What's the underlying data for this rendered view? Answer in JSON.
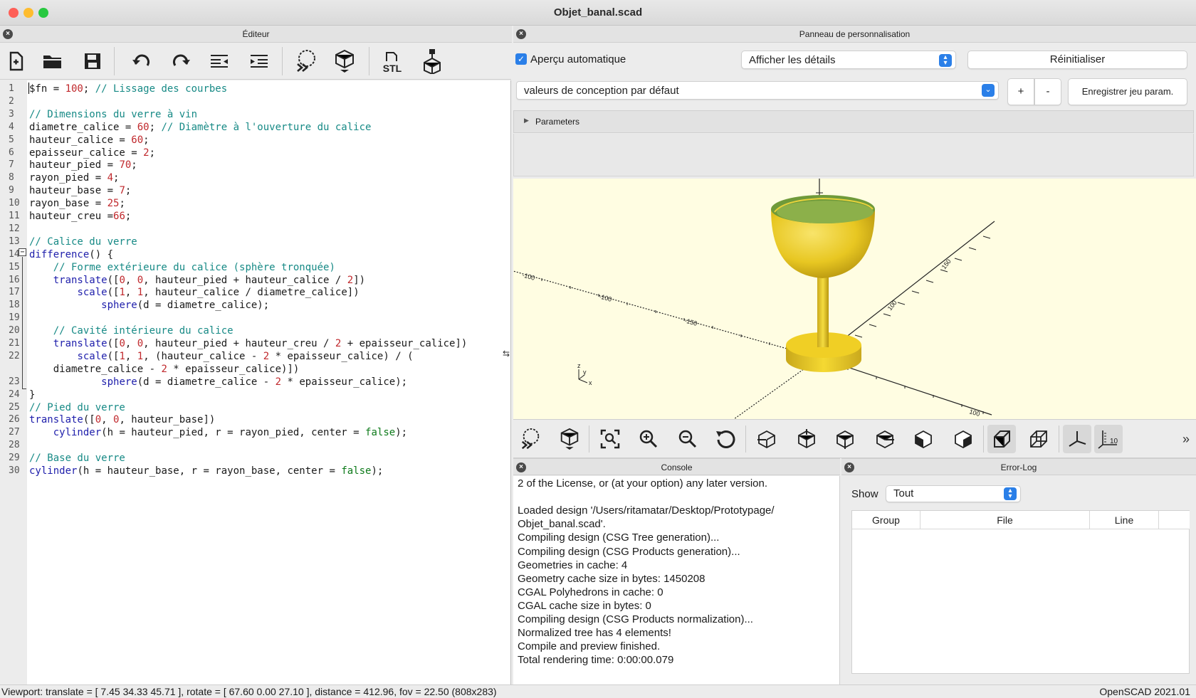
{
  "window": {
    "title": "Objet_banal.scad",
    "colors": {
      "close": "#fe5f57",
      "minimize": "#febc2e",
      "zoom": "#28c840"
    }
  },
  "editor": {
    "header": "Éditeur",
    "toolbar": [
      "new-file-icon",
      "open-folder-icon",
      "save-icon",
      "undo-icon",
      "redo-icon",
      "unindent-icon",
      "indent-icon",
      "preview-icon",
      "render-icon",
      "export-stl-icon",
      "send-to-3d-print-icon"
    ],
    "stl_label": "STL",
    "lines": [
      {
        "n": "1",
        "t": [
          [
            "pl",
            "$fn = "
          ],
          [
            "num",
            "100"
          ],
          [
            "pl",
            "; "
          ],
          [
            "cm",
            "// Lissage des courbes"
          ]
        ]
      },
      {
        "n": "2",
        "t": []
      },
      {
        "n": "3",
        "t": [
          [
            "cm",
            "// Dimensions du verre à vin"
          ]
        ]
      },
      {
        "n": "4",
        "t": [
          [
            "pl",
            "diametre_calice = "
          ],
          [
            "num",
            "60"
          ],
          [
            "pl",
            "; "
          ],
          [
            "cm",
            "// Diamètre à l'ouverture du calice"
          ]
        ]
      },
      {
        "n": "5",
        "t": [
          [
            "pl",
            "hauteur_calice = "
          ],
          [
            "num",
            "60"
          ],
          [
            "pl",
            ";"
          ]
        ]
      },
      {
        "n": "6",
        "t": [
          [
            "pl",
            "epaisseur_calice = "
          ],
          [
            "num",
            "2"
          ],
          [
            "pl",
            ";"
          ]
        ]
      },
      {
        "n": "7",
        "t": [
          [
            "pl",
            "hauteur_pied = "
          ],
          [
            "num",
            "70"
          ],
          [
            "pl",
            ";"
          ]
        ]
      },
      {
        "n": "8",
        "t": [
          [
            "pl",
            "rayon_pied = "
          ],
          [
            "num",
            "4"
          ],
          [
            "pl",
            ";"
          ]
        ]
      },
      {
        "n": "9",
        "t": [
          [
            "pl",
            "hauteur_base = "
          ],
          [
            "num",
            "7"
          ],
          [
            "pl",
            ";"
          ]
        ]
      },
      {
        "n": "10",
        "t": [
          [
            "pl",
            "rayon_base = "
          ],
          [
            "num",
            "25"
          ],
          [
            "pl",
            ";"
          ]
        ]
      },
      {
        "n": "11",
        "t": [
          [
            "pl",
            "hauteur_creu ="
          ],
          [
            "num",
            "66"
          ],
          [
            "pl",
            ";"
          ]
        ]
      },
      {
        "n": "12",
        "t": []
      },
      {
        "n": "13",
        "t": [
          [
            "cm",
            "// Calice du verre"
          ]
        ]
      },
      {
        "n": "14",
        "t": [
          [
            "kw",
            "difference"
          ],
          [
            "pl",
            "() {"
          ]
        ]
      },
      {
        "n": "15",
        "t": [
          [
            "pl",
            "    "
          ],
          [
            "cm",
            "// Forme extérieure du calice (sphère tronquée)"
          ]
        ]
      },
      {
        "n": "16",
        "t": [
          [
            "pl",
            "    "
          ],
          [
            "kw",
            "translate"
          ],
          [
            "pl",
            "(["
          ],
          [
            "num",
            "0"
          ],
          [
            "pl",
            ", "
          ],
          [
            "num",
            "0"
          ],
          [
            "pl",
            ", hauteur_pied + hauteur_calice / "
          ],
          [
            "num",
            "2"
          ],
          [
            "pl",
            "])"
          ]
        ]
      },
      {
        "n": "17",
        "t": [
          [
            "pl",
            "        "
          ],
          [
            "kw",
            "scale"
          ],
          [
            "pl",
            "(["
          ],
          [
            "num",
            "1"
          ],
          [
            "pl",
            ", "
          ],
          [
            "num",
            "1"
          ],
          [
            "pl",
            ", hauteur_calice / diametre_calice])"
          ]
        ]
      },
      {
        "n": "18",
        "t": [
          [
            "pl",
            "            "
          ],
          [
            "kw",
            "sphere"
          ],
          [
            "pl",
            "(d = diametre_calice);"
          ]
        ]
      },
      {
        "n": "19",
        "t": []
      },
      {
        "n": "20",
        "t": [
          [
            "pl",
            "    "
          ],
          [
            "cm",
            "// Cavité intérieure du calice"
          ]
        ]
      },
      {
        "n": "21",
        "t": [
          [
            "pl",
            "    "
          ],
          [
            "kw",
            "translate"
          ],
          [
            "pl",
            "(["
          ],
          [
            "num",
            "0"
          ],
          [
            "pl",
            ", "
          ],
          [
            "num",
            "0"
          ],
          [
            "pl",
            ", hauteur_pied + hauteur_creu / "
          ],
          [
            "num",
            "2"
          ],
          [
            "pl",
            " + epaisseur_calice])"
          ]
        ]
      },
      {
        "n": "22",
        "t": [
          [
            "pl",
            "        "
          ],
          [
            "kw",
            "scale"
          ],
          [
            "pl",
            "(["
          ],
          [
            "num",
            "1"
          ],
          [
            "pl",
            ", "
          ],
          [
            "num",
            "1"
          ],
          [
            "pl",
            ", (hauteur_calice - "
          ],
          [
            "num",
            "2"
          ],
          [
            "pl",
            " * epaisseur_calice) / ("
          ]
        ]
      },
      {
        "n": "",
        "t": [
          [
            "pl",
            "    diametre_calice - "
          ],
          [
            "num",
            "2"
          ],
          [
            "pl",
            " * epaisseur_calice)])"
          ]
        ]
      },
      {
        "n": "23",
        "t": [
          [
            "pl",
            "            "
          ],
          [
            "kw",
            "sphere"
          ],
          [
            "pl",
            "(d = diametre_calice - "
          ],
          [
            "num",
            "2"
          ],
          [
            "pl",
            " * epaisseur_calice);"
          ]
        ]
      },
      {
        "n": "24",
        "t": [
          [
            "pl",
            "}"
          ]
        ]
      },
      {
        "n": "25",
        "t": [
          [
            "cm",
            "// Pied du verre"
          ]
        ]
      },
      {
        "n": "26",
        "t": [
          [
            "kw",
            "translate"
          ],
          [
            "pl",
            "(["
          ],
          [
            "num",
            "0"
          ],
          [
            "pl",
            ", "
          ],
          [
            "num",
            "0"
          ],
          [
            "pl",
            ", hauteur_base])"
          ]
        ]
      },
      {
        "n": "27",
        "t": [
          [
            "pl",
            "    "
          ],
          [
            "kw",
            "cylinder"
          ],
          [
            "pl",
            "(h = hauteur_pied, r = rayon_pied, center = "
          ],
          [
            "bool",
            "false"
          ],
          [
            "pl",
            ");"
          ]
        ]
      },
      {
        "n": "28",
        "t": []
      },
      {
        "n": "29",
        "t": [
          [
            "cm",
            "// Base du verre"
          ]
        ]
      },
      {
        "n": "30",
        "t": [
          [
            "kw",
            "cylinder"
          ],
          [
            "pl",
            "(h = hauteur_base, r = rayon_base, center = "
          ],
          [
            "bool",
            "false"
          ],
          [
            "pl",
            ");"
          ]
        ]
      }
    ]
  },
  "customizer": {
    "header": "Panneau de personnalisation",
    "auto_preview_label": "Aperçu automatique",
    "auto_preview_checked": true,
    "details_select": "Afficher les détails",
    "reset_button": "Réinitialiser",
    "preset_select": "valeurs de conception par défaut",
    "plus_button": "+",
    "minus_button": "-",
    "save_preset_button": "Enregistrer jeu param.",
    "parameters_label": "Parameters"
  },
  "viewport": {
    "model_color": "#f2d32e",
    "background": "#fffde2",
    "axis_tick_labels": [
      "-100",
      "-100",
      "-150",
      "100",
      "100",
      "150"
    ]
  },
  "view_toolbar": [
    "preview-icon",
    "render-icon",
    "view-all-icon",
    "zoom-in-icon",
    "zoom-out-icon",
    "reset-view-icon",
    "view-right-icon",
    "view-top-icon",
    "view-bottom-icon",
    "view-left-icon",
    "view-front-icon",
    "view-back-icon",
    "perspective-icon",
    "orthogonal-icon",
    "show-axes-icon",
    "show-scale-icon",
    "more-icon"
  ],
  "console": {
    "header": "Console",
    "lines": [
      "2 of the License, or (at your option) any later version.",
      "",
      "Loaded design '/Users/ritamatar/Desktop/Prototypage/",
      "Objet_banal.scad'.",
      "Compiling design (CSG Tree generation)...",
      "Compiling design (CSG Products generation)...",
      "Geometries in cache: 4",
      "Geometry cache size in bytes: 1450208",
      "CGAL Polyhedrons in cache: 0",
      "CGAL cache size in bytes: 0",
      "Compiling design (CSG Products normalization)...",
      "Normalized tree has 4 elements!",
      "Compile and preview finished.",
      "Total rendering time: 0:00:00.079"
    ]
  },
  "errorlog": {
    "header": "Error-Log",
    "show_label": "Show",
    "show_value": "Tout",
    "columns": [
      "Group",
      "File",
      "Line"
    ]
  },
  "status": {
    "viewport": "Viewport: translate = [ 7.45 34.33 45.71 ], rotate = [ 67.60 0.00 27.10 ], distance = 412.96, fov = 22.50 (808x283)",
    "version": "OpenSCAD 2021.01"
  }
}
